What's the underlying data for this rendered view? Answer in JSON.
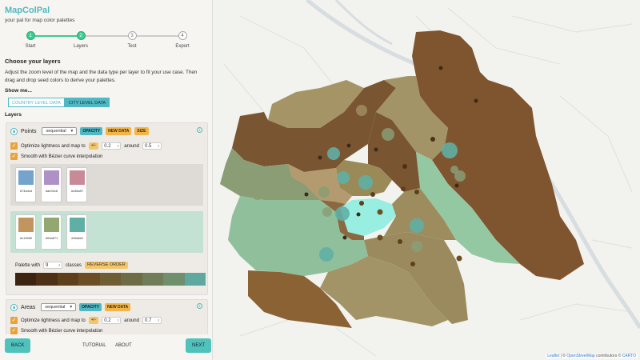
{
  "app": {
    "title": "MapColPal",
    "subtitle": "your pal for map color palettes"
  },
  "steps": [
    {
      "num": "1",
      "label": "Start",
      "state": "done"
    },
    {
      "num": "2",
      "label": "Layers",
      "state": "done"
    },
    {
      "num": "3",
      "label": "Test",
      "state": "todo"
    },
    {
      "num": "4",
      "label": "Export",
      "state": "todo"
    }
  ],
  "section": {
    "title": "Choose your layers",
    "instructions": "Adjust the zoom level of the map and the data type per layer to fit your use case. Then drag and drop seed colors to derive your palettes.",
    "show_me": "Show me...",
    "country_level": "COUNTRY LEVEL DATA",
    "city_level": "CITY LEVEL DATA",
    "active_level": "city",
    "layers_title": "Layers"
  },
  "points_layer": {
    "name": "Points",
    "type": "sequential",
    "opacity_label": "OPACITY",
    "new_data_label": "NEW DATA",
    "size_label": "SIZE",
    "info": "i",
    "optimize_label": "Optimize lightness and map to",
    "pm_label": "+/-",
    "lightness_value": "0.2",
    "around_label": "around",
    "around_value": "0.5",
    "smooth_label": "Smooth with Bézier curve interpolation",
    "seeds_grey": [
      {
        "hex": "#74a4cd",
        "color": "#74a4cd"
      },
      {
        "hex": "#ae92c6",
        "color": "#ae92c6"
      },
      {
        "hex": "#c98a97",
        "color": "#c98a97"
      }
    ],
    "seeds_green": [
      {
        "hex": "#c19560",
        "color": "#c19560"
      },
      {
        "hex": "#93a871",
        "color": "#93a871"
      },
      {
        "hex": "#60afa5",
        "color": "#60afa5"
      }
    ],
    "palette_with_label": "Palette with",
    "classes_value": "9",
    "classes_label": "classes",
    "reverse_label": "REVERSE ORDER",
    "palette": [
      "#3d2410",
      "#4d3016",
      "#5d3f1c",
      "#6b4e24",
      "#6f5d34",
      "#6e6c45",
      "#6f7d58",
      "#6f8f6d",
      "#5fa89f"
    ]
  },
  "areas_layer": {
    "name": "Areas",
    "type": "sequential",
    "opacity_label": "OPACITY",
    "new_data_label": "NEW DATA",
    "info": "i",
    "optimize_label": "Optimize lightness and map to",
    "pm_label": "+/-",
    "lightness_value": "0.2",
    "around_label": "around",
    "around_value": "0.7",
    "smooth_label": "Smooth with Bézier curve interpolation"
  },
  "nav": {
    "back": "BACK",
    "tutorial": "TUTORIAL",
    "about": "ABOUT",
    "next": "NEXT"
  },
  "attribution": {
    "leaflet": "Leaflet",
    "sep1": " | © ",
    "osm": "OpenStreetMap",
    "contributors": " contributors © ",
    "carto": "CARTO"
  }
}
